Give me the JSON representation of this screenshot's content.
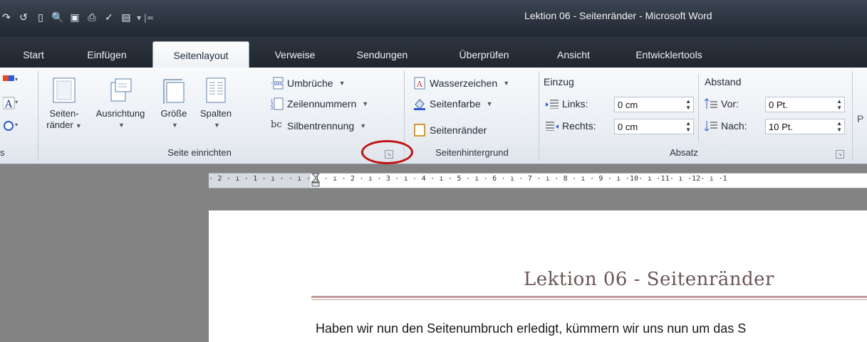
{
  "window": {
    "title": "Lektion 06 - Seitenränder  -  Microsoft Word"
  },
  "tabs": [
    {
      "label": "Start"
    },
    {
      "label": "Einfügen"
    },
    {
      "label": "Seitenlayout"
    },
    {
      "label": "Verweise"
    },
    {
      "label": "Sendungen"
    },
    {
      "label": "Überprüfen"
    },
    {
      "label": "Ansicht"
    },
    {
      "label": "Entwicklertools"
    }
  ],
  "ribbon": {
    "partial_group_label": "s",
    "seite_einrichten": {
      "label": "Seite einrichten",
      "seitenraender_l1": "Seiten-",
      "seitenraender_l2": "ränder",
      "ausrichtung": "Ausrichtung",
      "groesse": "Größe",
      "spalten": "Spalten",
      "umbrueche": "Umbrüche",
      "zeilennummern": "Zeilennummern",
      "silbentrennung": "Silbentrennung",
      "silben_icon_text": "bc"
    },
    "seitenhintergrund": {
      "label": "Seitenhintergrund",
      "wasserzeichen": "Wasserzeichen",
      "seitenfarbe": "Seitenfarbe",
      "seitenraender": "Seitenränder"
    },
    "absatz": {
      "label": "Absatz",
      "einzug": "Einzug",
      "links_label": "Links:",
      "links_value": "0 cm",
      "rechts_label": "Rechts:",
      "rechts_value": "0 cm",
      "abstand": "Abstand",
      "vor_label": "Vor:",
      "vor_value": "0 Pt.",
      "nach_label": "Nach:",
      "nach_value": "10 Pt."
    },
    "partial_next": "P"
  },
  "ruler": {
    "ticks": "· 2 · ı · 1 · ı ·   · ı · 1 · ı · 2 · ı · 3 · ı · 4 · ı · 5 · ı · 6 · ı · 7 · ı · 8 · ı · 9 · ı ·10· ı ·11· ı ·12· ı ·1"
  },
  "document": {
    "heading": "Lektion 06 - Seitenränder",
    "body": "Haben wir nun den Seitenumbruch erledigt, kümmern wir uns nun um das S"
  },
  "colors": {
    "annotation_circle": "#c01313",
    "heading_rule": "#c29a9a"
  }
}
